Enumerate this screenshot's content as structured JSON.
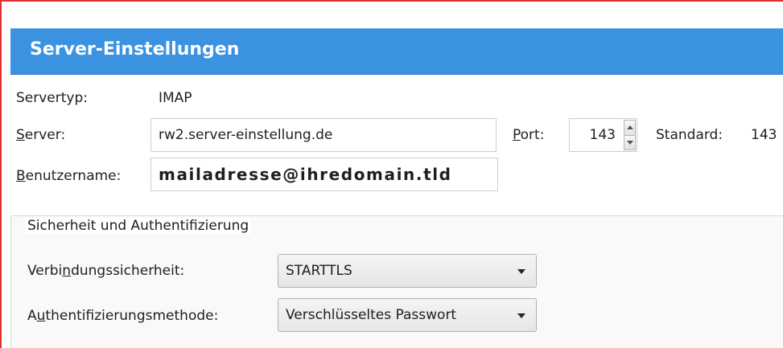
{
  "header": {
    "title": "Server-Einstellungen"
  },
  "server_type": {
    "label": "Servertyp:",
    "value": "IMAP"
  },
  "server": {
    "label_prefix": "",
    "label_access": "S",
    "label_rest": "erver:",
    "value": "rw2.server-einstellung.de"
  },
  "port": {
    "label_access": "P",
    "label_rest": "ort:",
    "value": "143",
    "default_label": "Standard:",
    "default_value": "143"
  },
  "username": {
    "label_access": "B",
    "label_rest": "enutzername:",
    "value": "mailadresse@ihredomain.tld"
  },
  "security": {
    "legend": "Sicherheit und Authentifizierung",
    "connection": {
      "label_pre": "Verbi",
      "label_access": "n",
      "label_post": "dungssicherheit:",
      "value": "STARTTLS"
    },
    "auth": {
      "label_pre": "A",
      "label_access": "u",
      "label_post": "thentifizierungsmethode:",
      "value": "Verschlüsseltes Passwort"
    }
  },
  "colors": {
    "header_bg": "#3a92e0",
    "frame_border": "#e03030"
  },
  "icons": {
    "spin_up": "triangle-up-icon",
    "spin_down": "triangle-down-icon",
    "dropdown": "chevron-down-icon"
  }
}
